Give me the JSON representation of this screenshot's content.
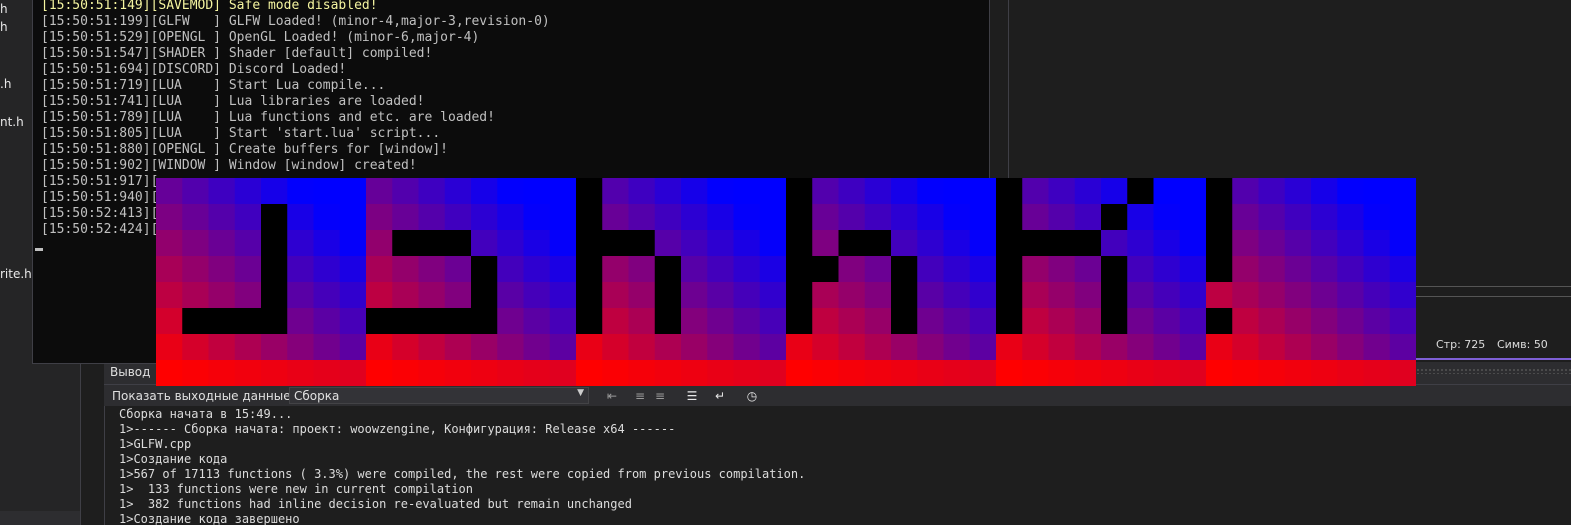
{
  "solution_explorer": {
    "files": [
      {
        "label": "h"
      },
      {
        "label": "h"
      },
      {
        "label": ".h"
      },
      {
        "label": "nt.h"
      },
      {
        "label": "rite.h"
      }
    ]
  },
  "console": {
    "lines": [
      {
        "text": "[15:50:51:149][SAVEMOD] Safe mode disabled!",
        "highlight": true
      },
      {
        "text": "[15:50:51:199][GLFW   ] GLFW Loaded! (minor-4,major-3,revision-0)"
      },
      {
        "text": "[15:50:51:529][OPENGL ] OpenGL Loaded! (minor-6,major-4)"
      },
      {
        "text": "[15:50:51:547][SHADER ] Shader [default] compiled!"
      },
      {
        "text": "[15:50:51:694][DISCORD] Discord Loaded!"
      },
      {
        "text": "[15:50:51:719][LUA    ] Start Lua compile..."
      },
      {
        "text": "[15:50:51:741][LUA    ] Lua libraries are loaded!"
      },
      {
        "text": "[15:50:51:789][LUA    ] Lua functions and etc. are loaded!"
      },
      {
        "text": "[15:50:51:805][LUA    ] Start 'start.lua' script..."
      },
      {
        "text": "[15:50:51:880][OPENGL ] Create buffers for [window]!"
      },
      {
        "text": "[15:50:51:902][WINDOW ] Window [window] created!"
      },
      {
        "text": "[15:50:51:917]["
      },
      {
        "text": "[15:50:51:940]["
      },
      {
        "text": "[15:50:52:413]["
      },
      {
        "text": "[15:50:52:424]["
      }
    ]
  },
  "status": {
    "line_label": "Стр: 725",
    "col_label": "Симв: 50"
  },
  "output_panel": {
    "tab_label": "Вывод",
    "show_output_label": "Показать выходные данные из:",
    "source_value": "Сборка",
    "lines": [
      "Сборка начата в 15:49...",
      "1>------ Сборка начата: проект: woowzengine, Конфигурация: Release x64 ------",
      "1>GLFW.cpp",
      "1>Создание кода",
      "1>567 of 17113 functions ( 3.3%) were compiled, the rest were copied from previous compilation.",
      "1>  133 functions were new in current compilation",
      "1>  382 functions had inline decision re-evaluated but remain unchanged",
      "1>Создание кода завершено"
    ]
  },
  "icons": {
    "toolbar": [
      "go-to-prev-message-icon",
      "prev-icon",
      "next-icon",
      "clear-all-icon",
      "word-wrap-icon",
      "clock-icon"
    ]
  },
  "colors": {
    "banner_red": "#ff0000",
    "banner_blue": "#0000ff",
    "banner_purple": "#8b00a8",
    "status_accent": "#7e5fd6",
    "console_highlight": "#f5f5a0"
  }
}
